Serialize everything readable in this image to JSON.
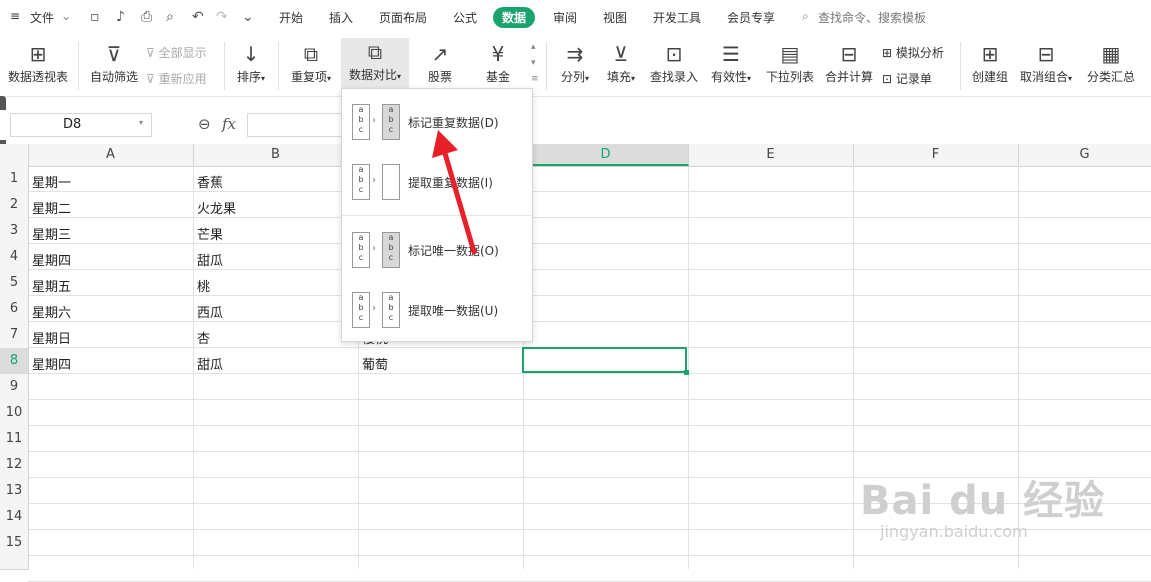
{
  "menubar": {
    "hamburger": "≡",
    "file_label": "文件",
    "tabs": [
      "开始",
      "插入",
      "页面布局",
      "公式",
      "数据",
      "审阅",
      "视图",
      "开发工具",
      "会员专享"
    ],
    "active_tab": "数据",
    "search_placeholder": "查找命令、搜索模板"
  },
  "ribbon": {
    "pivot": "数据透视表",
    "autofilter": "自动筛选",
    "show_all": "全部显示",
    "reapply": "重新应用",
    "sort": "排序",
    "duplicates": "重复项",
    "compare": "数据对比",
    "stocks": "股票",
    "funds": "基金",
    "split": "分列",
    "fill": "填充",
    "lookup": "查找录入",
    "validity": "有效性",
    "dropdown_list": "下拉列表",
    "merge_calc": "合并计算",
    "simulate": "模拟分析",
    "record": "记录单",
    "create_group": "创建组",
    "ungroup": "取消组合",
    "subtotal": "分类汇总"
  },
  "formula_bar": {
    "name_box": "D8",
    "fx": "fx"
  },
  "grid": {
    "columns": [
      "A",
      "B",
      "C",
      "D",
      "E",
      "F",
      "G"
    ],
    "rows": [
      "1",
      "2",
      "3",
      "4",
      "5",
      "6",
      "7",
      "8",
      "9",
      "10",
      "11",
      "12",
      "13",
      "14",
      "15"
    ],
    "col_a": [
      "星期一",
      "星期二",
      "星期三",
      "星期四",
      "星期五",
      "星期六",
      "星期日",
      "星期四"
    ],
    "col_b": [
      "香蕉",
      "火龙果",
      "芒果",
      "甜瓜",
      "桃",
      "西瓜",
      "杏",
      "甜瓜"
    ],
    "col_c_visible": [
      "樱桃",
      "葡萄"
    ],
    "selected_cell": "D8"
  },
  "dropdown": {
    "items": [
      {
        "label": "标记重复数据(D)"
      },
      {
        "label": "提取重复数据(I)"
      },
      {
        "label": "标记唯一数据(O)"
      },
      {
        "label": "提取唯一数据(U)"
      }
    ],
    "mini_letters": [
      "a",
      "b",
      "c"
    ]
  },
  "colors": {
    "accent": "#1aa36d",
    "annotation_arrow": "#e8202a"
  },
  "watermark": {
    "brand": "Bai du 经验",
    "url": "jingyan.baidu.com"
  }
}
